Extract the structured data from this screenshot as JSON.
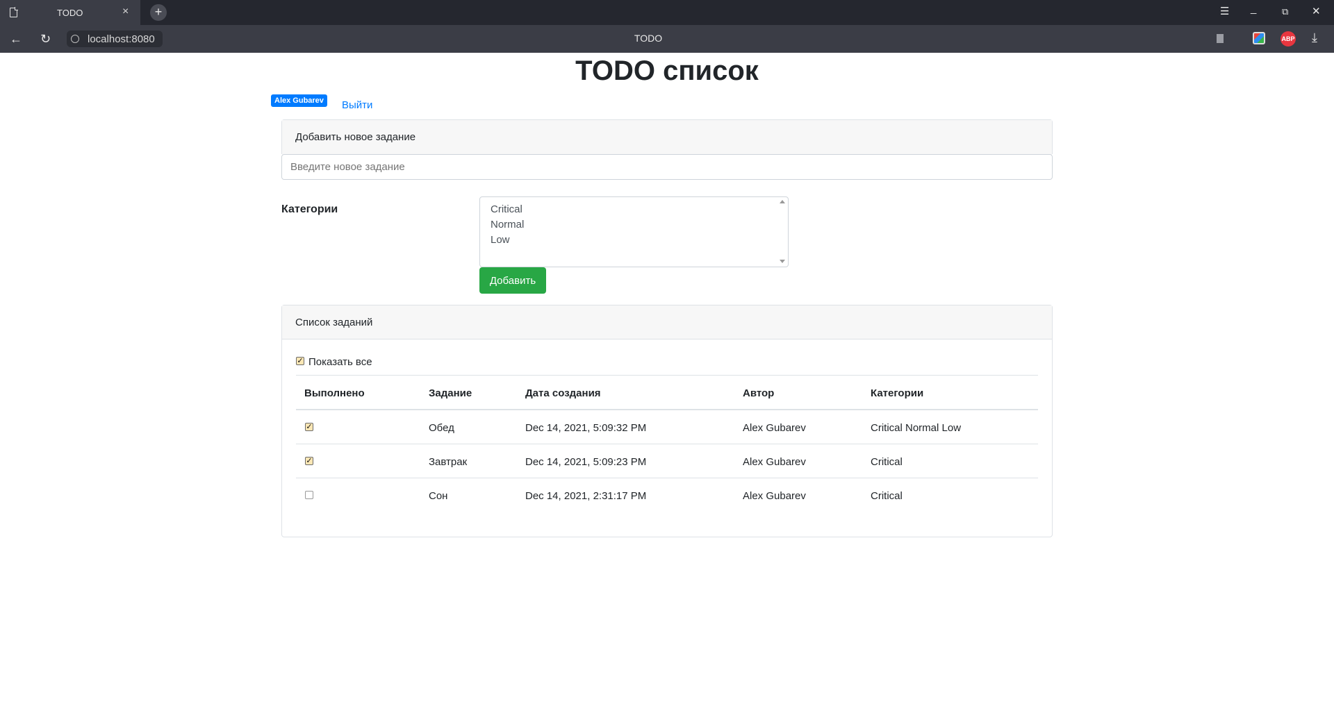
{
  "browser": {
    "tab_title": "TODO",
    "tab_close": "×",
    "new_tab": "+",
    "url": "localhost:8080",
    "page_title": "TODO",
    "abp_label": "ABP"
  },
  "header": {
    "title": "TODO список",
    "user_name": "Alex Gubarev",
    "logout_label": "Выйти"
  },
  "add_task": {
    "header": "Добавить новое задание",
    "placeholder": "Введите новое задание",
    "categories_label": "Категории",
    "categories": [
      "Critical",
      "Normal",
      "Low"
    ],
    "add_button": "Добавить"
  },
  "task_list": {
    "header": "Список заданий",
    "show_all_label": "Показать все",
    "show_all_checked": true,
    "columns": [
      "Выполнено",
      "Задание",
      "Дата создания",
      "Автор",
      "Категории"
    ],
    "rows": [
      {
        "done": true,
        "task": "Обед",
        "created": "Dec 14, 2021, 5:09:32 PM",
        "author": "Alex Gubarev",
        "categories": "Critical Normal Low"
      },
      {
        "done": true,
        "task": "Завтрак",
        "created": "Dec 14, 2021, 5:09:23 PM",
        "author": "Alex Gubarev",
        "categories": "Critical"
      },
      {
        "done": false,
        "task": "Сон",
        "created": "Dec 14, 2021, 2:31:17 PM",
        "author": "Alex Gubarev",
        "categories": "Critical"
      }
    ]
  },
  "colors": {
    "primary": "#007bff",
    "success": "#28a745"
  },
  "icons": {
    "back": "back-arrow-icon",
    "reload": "reload-icon",
    "menu": "menu-icon",
    "minimize": "minimize-icon",
    "restore": "restore-icon",
    "close": "close-icon",
    "download": "download-icon"
  }
}
